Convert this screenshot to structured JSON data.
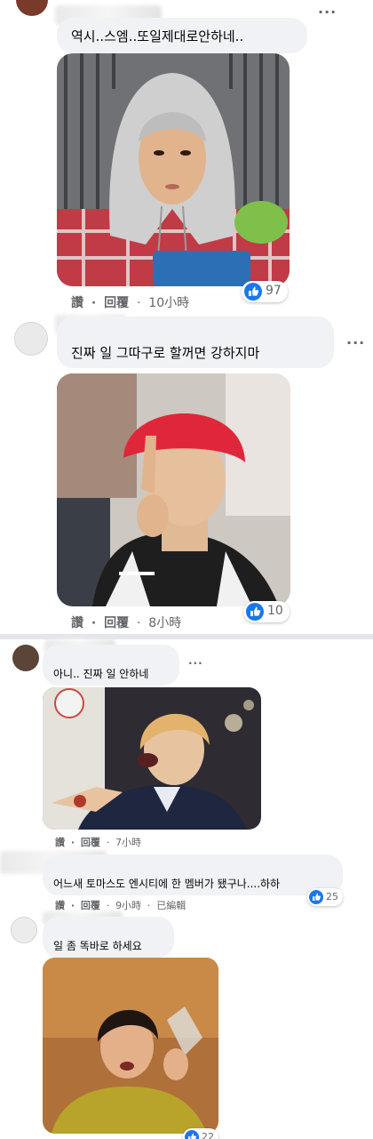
{
  "comments": [
    {
      "text": "역시..스엠..또일제대로안하네..",
      "actions": {
        "like": "讚",
        "reply": "回覆",
        "sep": "·",
        "time": "10小時"
      },
      "reactions": "97"
    },
    {
      "text": "진짜 일 그따구로 할꺼면 강하지마",
      "actions": {
        "like": "讚",
        "reply": "回覆",
        "sep": "·",
        "time": "8小時"
      },
      "reactions": "10"
    },
    {
      "text": "아니.. 진짜 일 안하네",
      "actions": {
        "like": "讚",
        "reply": "回覆",
        "sep": "·",
        "time": "7小時"
      }
    },
    {
      "text": "어느새 토마스도 엔시티에 한 멤버가 됐구나....하하",
      "actions": {
        "like": "讚",
        "reply": "回覆",
        "sep": "·",
        "time": "9小時",
        "edited": "已編輯"
      },
      "reactions": "25"
    },
    {
      "text": "일 좀 똑바로 하세요",
      "reactions": "22"
    }
  ],
  "ui": {
    "more": "···",
    "like_color": "#1877f2",
    "bubble_color": "#f0f2f5",
    "meta_color": "#65676b"
  }
}
